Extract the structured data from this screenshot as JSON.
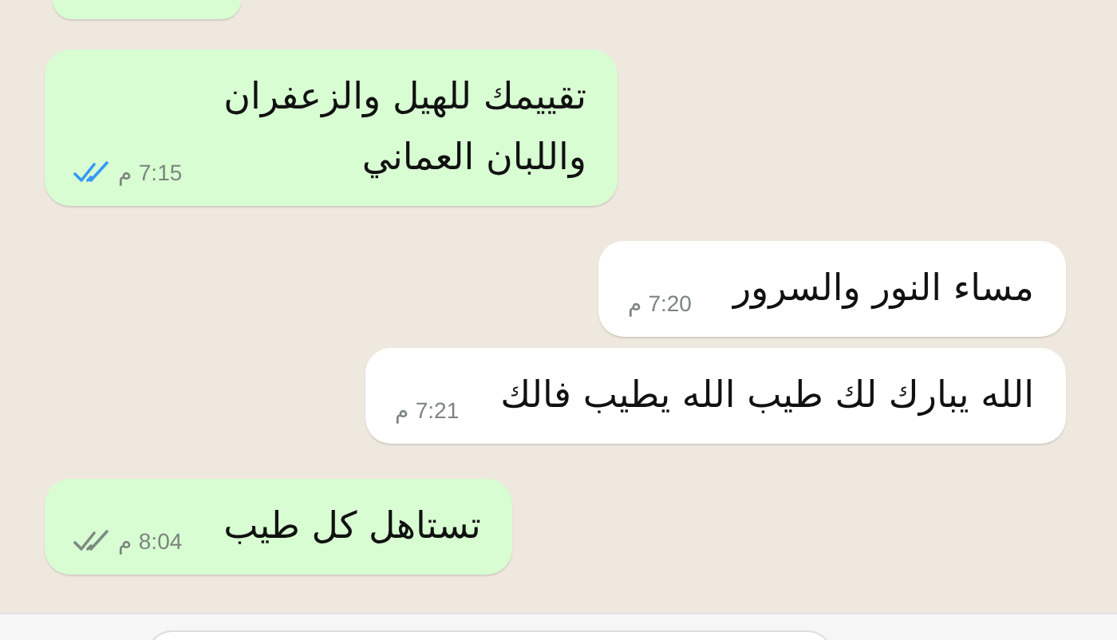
{
  "messages": [
    {
      "kind": "outgoing",
      "partial": true
    },
    {
      "kind": "outgoing",
      "text": "تقييمك للهيل والزعفران\nواللبان العماني",
      "time": "7:15 م",
      "read": true
    },
    {
      "kind": "incoming",
      "text": "مساء النور والسرور",
      "time": "7:20 م"
    },
    {
      "kind": "incoming",
      "text": "الله يبارك لك طيب الله يطيب فالك",
      "time": "7:21 م"
    },
    {
      "kind": "outgoing",
      "text": "تستاهل كل طيب",
      "time": "8:04 م",
      "read": false
    }
  ],
  "composer": {
    "kind": "field"
  }
}
